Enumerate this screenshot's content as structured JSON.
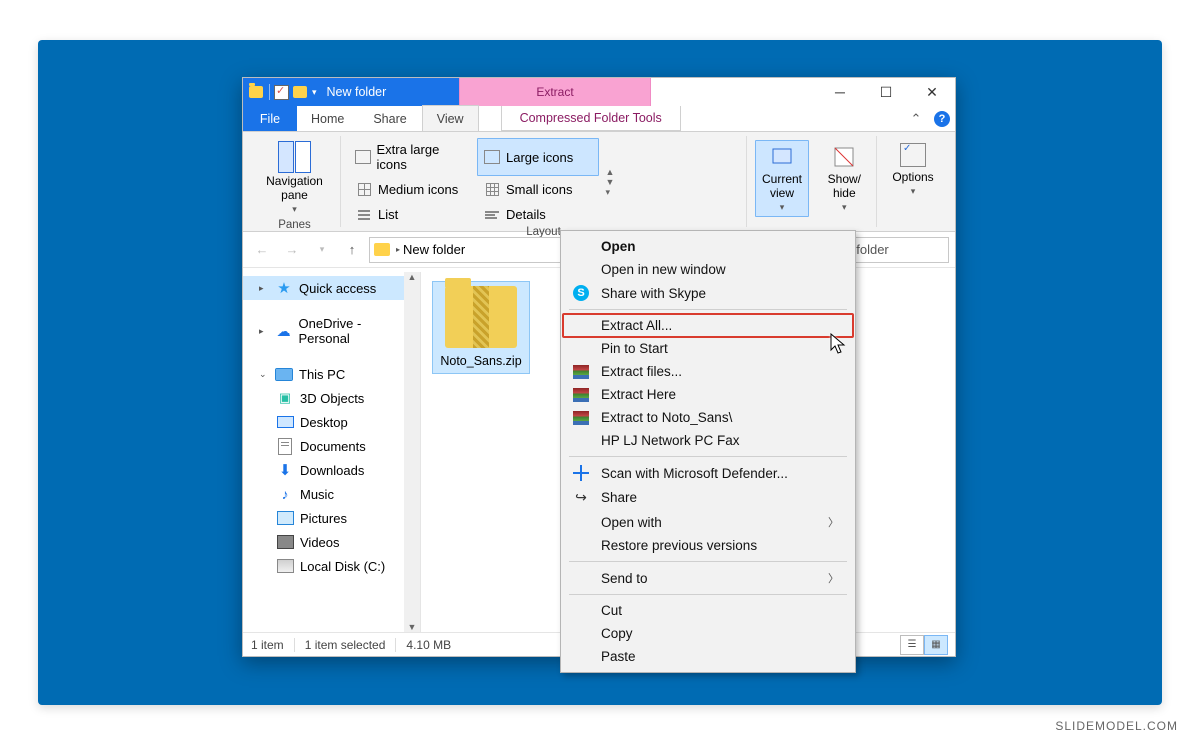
{
  "window": {
    "title": "New folder",
    "contextualTab": "Extract",
    "contextualTabGroup": "Compressed Folder Tools",
    "tabs": {
      "file": "File",
      "home": "Home",
      "share": "Share",
      "view": "View"
    }
  },
  "ribbon": {
    "panes": "Panes",
    "navigationPane": "Navigation\npane",
    "layout": "Layout",
    "layoutItems": {
      "extraLarge": "Extra large icons",
      "large": "Large icons",
      "medium": "Medium icons",
      "small": "Small icons",
      "list": "List",
      "details": "Details"
    },
    "currentView": "Current\nview",
    "showHide": "Show/\nhide",
    "options": "Options"
  },
  "address": {
    "crumb": "New folder",
    "search": "ew folder"
  },
  "sidebar": {
    "quickAccess": "Quick access",
    "onedrive": "OneDrive - Personal",
    "thisPC": "This PC",
    "threeD": "3D Objects",
    "desktop": "Desktop",
    "documents": "Documents",
    "downloads": "Downloads",
    "music": "Music",
    "pictures": "Pictures",
    "videos": "Videos",
    "localDisk": "Local Disk (C:)"
  },
  "file": {
    "name": "Noto_Sans.zip"
  },
  "status": {
    "items": "1 item",
    "selected": "1 item selected",
    "size": "4.10 MB"
  },
  "context": {
    "open": "Open",
    "openNew": "Open in new window",
    "shareSkype": "Share with Skype",
    "extractAll": "Extract All...",
    "pinStart": "Pin to Start",
    "extractFiles": "Extract files...",
    "extractHere": "Extract Here",
    "extractTo": "Extract to Noto_Sans\\",
    "hpFax": "HP LJ Network PC Fax",
    "defender": "Scan with Microsoft Defender...",
    "share": "Share",
    "openWith": "Open with",
    "restore": "Restore previous versions",
    "sendTo": "Send to",
    "cut": "Cut",
    "copy": "Copy",
    "paste": "Paste"
  },
  "watermark": "SLIDEMODEL.COM"
}
